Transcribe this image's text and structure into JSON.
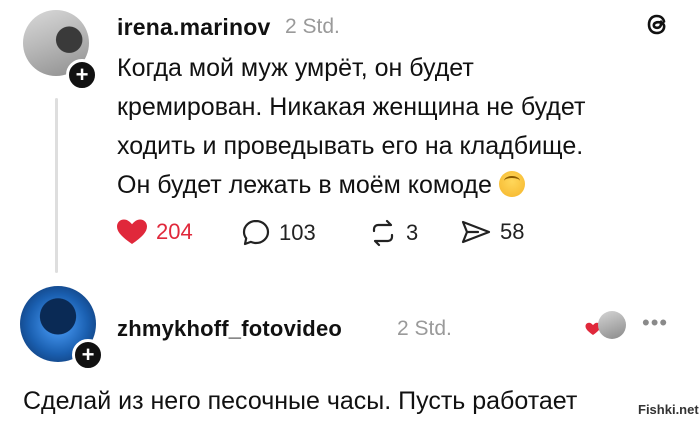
{
  "post": {
    "username": "irena.marinov",
    "time": "2 Std.",
    "text": "Когда мой муж умрёт, он будет кремирован. Никакая женщина не будет ходить и проведывать его на кладбище. Он будет лежать в моём комоде",
    "emoji_icon": "relieved-smile-icon",
    "likes": "204",
    "comments": "103",
    "reposts": "3",
    "shares": "58"
  },
  "reply": {
    "username": "zhmykhoff_fotovideo",
    "time": "2 Std.",
    "text": "Сделай из него песочные часы. Пусть работает"
  },
  "watermark": "Fishki.net",
  "colors": {
    "like": "#e0283b",
    "muted": "#9a9a9a",
    "text": "#111111"
  }
}
